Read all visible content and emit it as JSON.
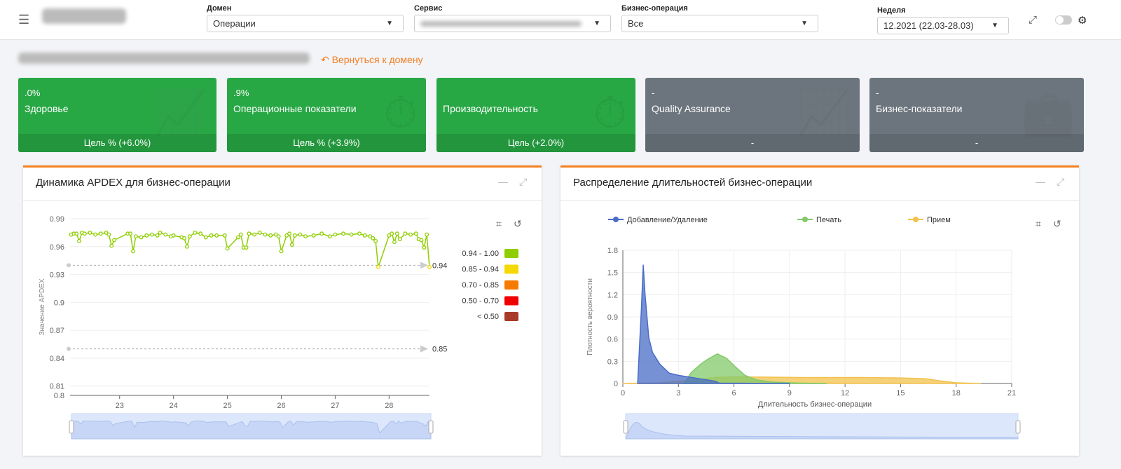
{
  "header": {
    "filters": [
      {
        "label": "Домен",
        "value": "Операции"
      },
      {
        "label": "Сервис",
        "value": ""
      },
      {
        "label": "Бизнес-операция",
        "value": "Все"
      },
      {
        "label": "Неделя",
        "value": "12.2021 (22.03-28.03)"
      }
    ],
    "icons": [
      "menu-icon",
      "expand-icon",
      "toggle",
      "gear-icon"
    ]
  },
  "back_link": "Вернуться к домену",
  "cards": [
    {
      "value": ".0%",
      "name": "Здоровье",
      "foot": "Цель  % (+6.0%)",
      "icon": "chart-line-icon",
      "status": "green"
    },
    {
      "value": ".9%",
      "name": "Операционные показатели",
      "foot": "Цель  % (+3.9%)",
      "icon": "gauge-icon",
      "status": "green"
    },
    {
      "value": "",
      "name": "Производительность",
      "foot": "Цель  (+2.0%)",
      "icon": "stopwatch-icon",
      "status": "green"
    },
    {
      "value": "-",
      "name": "Quality Assurance",
      "foot": "-",
      "icon": "chart-line-icon",
      "status": "gray"
    },
    {
      "value": "-",
      "name": "Бизнес-показатели",
      "foot": "-",
      "icon": "briefcase-icon",
      "status": "gray"
    }
  ],
  "colors": {
    "green": "#28a745",
    "gray": "#6c757d",
    "accent": "#f58220"
  },
  "panels": {
    "left_title": "Динамика APDEX для бизнес-операции",
    "right_title": "Распределение длительностей бизнес-операции"
  },
  "chart_data": [
    {
      "type": "line",
      "ylabel": "Значение APDEX",
      "ylim": [
        0.8,
        0.99
      ],
      "yticks": [
        "0.99",
        "0.96",
        "0.93",
        "0.9",
        "0.87",
        "0.84",
        "0.81",
        "0.8"
      ],
      "xticks": [
        "23",
        "24",
        "25",
        "26",
        "27",
        "28"
      ],
      "xlim": [
        22.08,
        28.75
      ],
      "marklines": [
        {
          "value": 0.94,
          "label": "0.94"
        },
        {
          "value": 0.85,
          "label": "0.85"
        }
      ],
      "visual_map": [
        {
          "label": "0.94 - 1.00",
          "color": "#8fce00"
        },
        {
          "label": "0.85 - 0.94",
          "color": "#f5d800"
        },
        {
          "label": "0.70 - 0.85",
          "color": "#f57c00"
        },
        {
          "label": "0.50 - 0.70",
          "color": "#f00000"
        },
        {
          "label": "< 0.50",
          "color": "#a93a2a"
        }
      ],
      "x": [
        22.1,
        22.15,
        22.2,
        22.25,
        22.3,
        22.35,
        22.45,
        22.55,
        22.65,
        22.75,
        22.8,
        22.85,
        22.9,
        23.15,
        23.2,
        23.25,
        23.3,
        23.4,
        23.5,
        23.6,
        23.7,
        23.75,
        23.85,
        23.95,
        24.0,
        24.15,
        24.2,
        24.25,
        24.3,
        24.4,
        24.5,
        24.6,
        24.7,
        24.8,
        24.95,
        25.0,
        25.2,
        25.25,
        25.3,
        25.35,
        25.4,
        25.5,
        25.6,
        25.7,
        25.8,
        25.9,
        25.95,
        26.0,
        26.1,
        26.15,
        26.2,
        26.25,
        26.35,
        26.45,
        26.6,
        26.75,
        26.9,
        27.0,
        27.15,
        27.3,
        27.45,
        27.55,
        27.65,
        27.7,
        27.75,
        27.8,
        28.0,
        28.05,
        28.1,
        28.15,
        28.2,
        28.3,
        28.4,
        28.5,
        28.55,
        28.6,
        28.65,
        28.7,
        28.75
      ],
      "values": [
        0.973,
        0.974,
        0.974,
        0.966,
        0.975,
        0.974,
        0.975,
        0.973,
        0.974,
        0.975,
        0.973,
        0.961,
        0.967,
        0.974,
        0.974,
        0.955,
        0.971,
        0.97,
        0.972,
        0.973,
        0.972,
        0.975,
        0.973,
        0.971,
        0.972,
        0.97,
        0.969,
        0.96,
        0.971,
        0.975,
        0.974,
        0.97,
        0.972,
        0.972,
        0.972,
        0.958,
        0.97,
        0.973,
        0.959,
        0.959,
        0.974,
        0.973,
        0.975,
        0.973,
        0.972,
        0.973,
        0.971,
        0.955,
        0.972,
        0.974,
        0.962,
        0.972,
        0.973,
        0.971,
        0.972,
        0.974,
        0.971,
        0.973,
        0.974,
        0.973,
        0.974,
        0.972,
        0.971,
        0.969,
        0.966,
        0.938,
        0.972,
        0.974,
        0.965,
        0.974,
        0.968,
        0.974,
        0.973,
        0.974,
        0.968,
        0.967,
        0.959,
        0.973,
        0.938
      ]
    },
    {
      "type": "area",
      "xlabel": "Длительность бизнес-операции",
      "ylabel": "Плотность вероятности",
      "xlim": [
        0,
        21
      ],
      "ylim": [
        0,
        1.8
      ],
      "xticks": [
        "0",
        "3",
        "6",
        "9",
        "12",
        "15",
        "18",
        "21"
      ],
      "yticks": [
        "1.8",
        "1.5",
        "1.2",
        "0.9",
        "0.6",
        "0.3",
        "0"
      ],
      "series": [
        {
          "name": "Добавление/Удаление",
          "color": "#4a6cc7",
          "x": [
            0.8,
            1.0,
            1.1,
            1.2,
            1.4,
            1.6,
            2.0,
            2.5,
            3,
            4,
            5,
            5.2,
            9
          ],
          "values": [
            0,
            1.0,
            1.6,
            1.2,
            0.62,
            0.42,
            0.26,
            0.14,
            0.11,
            0.07,
            0.03,
            0.005,
            0
          ]
        },
        {
          "name": "Печать",
          "color": "#82c96a",
          "x": [
            3.3,
            3.7,
            4.2,
            4.6,
            5.1,
            5.6,
            6.1,
            6.6,
            7.2,
            8,
            9.5,
            11
          ],
          "values": [
            0,
            0.15,
            0.26,
            0.33,
            0.4,
            0.34,
            0.22,
            0.11,
            0.05,
            0.02,
            0.005,
            0
          ]
        },
        {
          "name": "Прием",
          "color": "#f2c14e",
          "x": [
            0,
            2,
            4,
            5,
            6,
            8,
            10,
            13,
            15,
            16.3,
            17.3,
            18,
            19.3
          ],
          "values": [
            0,
            0.01,
            0.05,
            0.08,
            0.09,
            0.085,
            0.08,
            0.08,
            0.075,
            0.065,
            0.03,
            0.01,
            0
          ]
        }
      ]
    }
  ]
}
